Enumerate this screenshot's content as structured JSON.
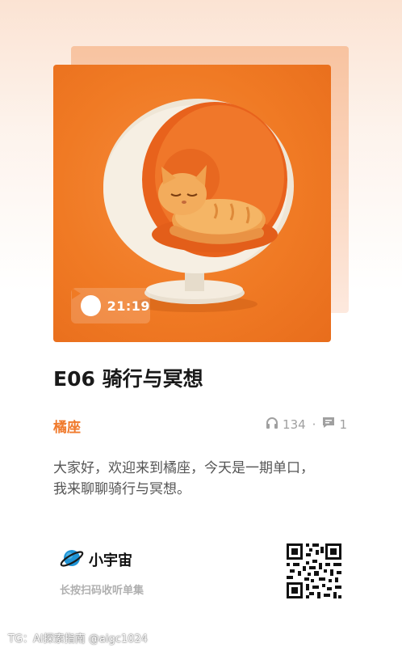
{
  "episode": {
    "duration": "21:19",
    "title": "E06 骑行与冥想",
    "author": "橘座",
    "listen_count": "134",
    "separator": "·",
    "comment_count": "1",
    "description_line1": "大家好，欢迎来到橘座，今天是一期单口，",
    "description_line2": "我来聊聊骑行与冥想。"
  },
  "brand": {
    "name": "小宇宙",
    "hint": "长按扫码收听单集"
  },
  "watermark": "TG：AI探索指南 @aigc1024",
  "colors": {
    "accent": "#f07a2c",
    "cover_bg": "#f07a24",
    "brand_blue": "#2a9fd8"
  },
  "icons": {
    "play": "play-icon",
    "headphones": "headphones-icon",
    "comment": "comment-icon",
    "logo": "planet-logo-icon",
    "qr": "qr-code"
  }
}
